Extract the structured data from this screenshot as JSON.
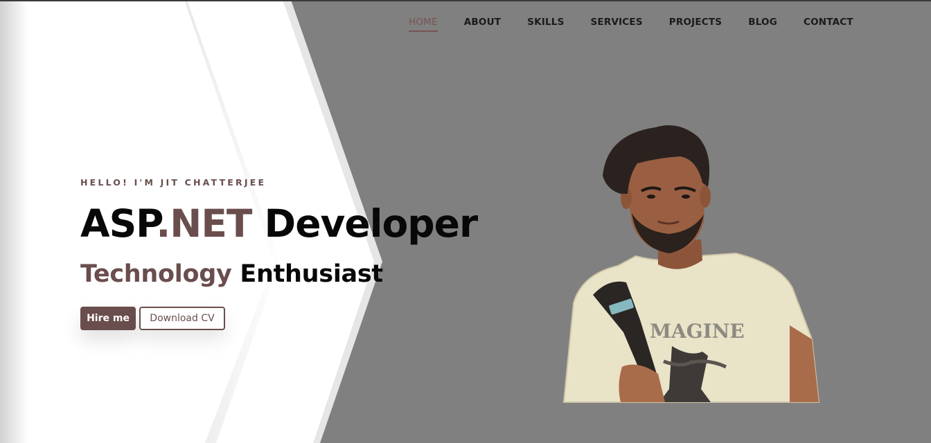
{
  "nav": {
    "items": [
      {
        "label": "HOME",
        "active": true
      },
      {
        "label": "ABOUT"
      },
      {
        "label": "SKILLS"
      },
      {
        "label": "SERVICES"
      },
      {
        "label": "PROJECTS"
      },
      {
        "label": "BLOG"
      },
      {
        "label": "CONTACT"
      }
    ]
  },
  "hero": {
    "greeting": "HELLO! I'M JIT CHATTERJEE",
    "title_part1": "ASP",
    "title_accent": ".NET",
    "title_part2": " Developer",
    "subtitle_accent": "Technology",
    "subtitle_rest": " Enthusiast",
    "hire_label": "Hire me",
    "cv_label": "Download CV"
  },
  "colors": {
    "accent": "#6a4d4d",
    "background": "#808080",
    "panel": "#ffffff"
  },
  "portrait": {
    "icon": "person-photo",
    "shirt_text": "MAGINE"
  }
}
